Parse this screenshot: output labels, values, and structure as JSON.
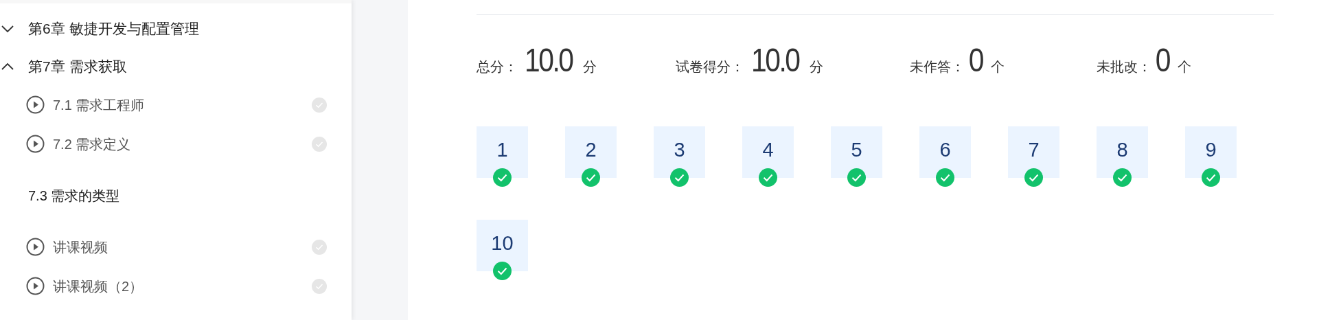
{
  "sidebar": {
    "chapters": [
      {
        "title": "第6章 敏捷开发与配置管理",
        "expanded": false
      },
      {
        "title": "第7章 需求获取",
        "expanded": true,
        "children": [
          {
            "kind": "video",
            "title": "7.1 需求工程师",
            "done": false
          },
          {
            "kind": "video",
            "title": "7.2 需求定义",
            "done": false
          },
          {
            "kind": "section",
            "title": "7.3 需求的类型"
          },
          {
            "kind": "video",
            "title": "讲课视频",
            "done": false
          },
          {
            "kind": "video",
            "title": "讲课视频（2）",
            "done": false
          }
        ]
      }
    ]
  },
  "summary": [
    {
      "label": "总分：",
      "value": "10.0",
      "unit": "分"
    },
    {
      "label": "试卷得分：",
      "value": "10.0",
      "unit": "分"
    },
    {
      "label": "未作答：",
      "value": "0",
      "unit": "个"
    },
    {
      "label": "未批改：",
      "value": "0",
      "unit": "个"
    }
  ],
  "questions": [
    {
      "number": "1",
      "correct": true
    },
    {
      "number": "2",
      "correct": true
    },
    {
      "number": "3",
      "correct": true
    },
    {
      "number": "4",
      "correct": true
    },
    {
      "number": "5",
      "correct": true
    },
    {
      "number": "6",
      "correct": true
    },
    {
      "number": "7",
      "correct": true
    },
    {
      "number": "8",
      "correct": true
    },
    {
      "number": "9",
      "correct": true
    },
    {
      "number": "10",
      "correct": true
    }
  ]
}
